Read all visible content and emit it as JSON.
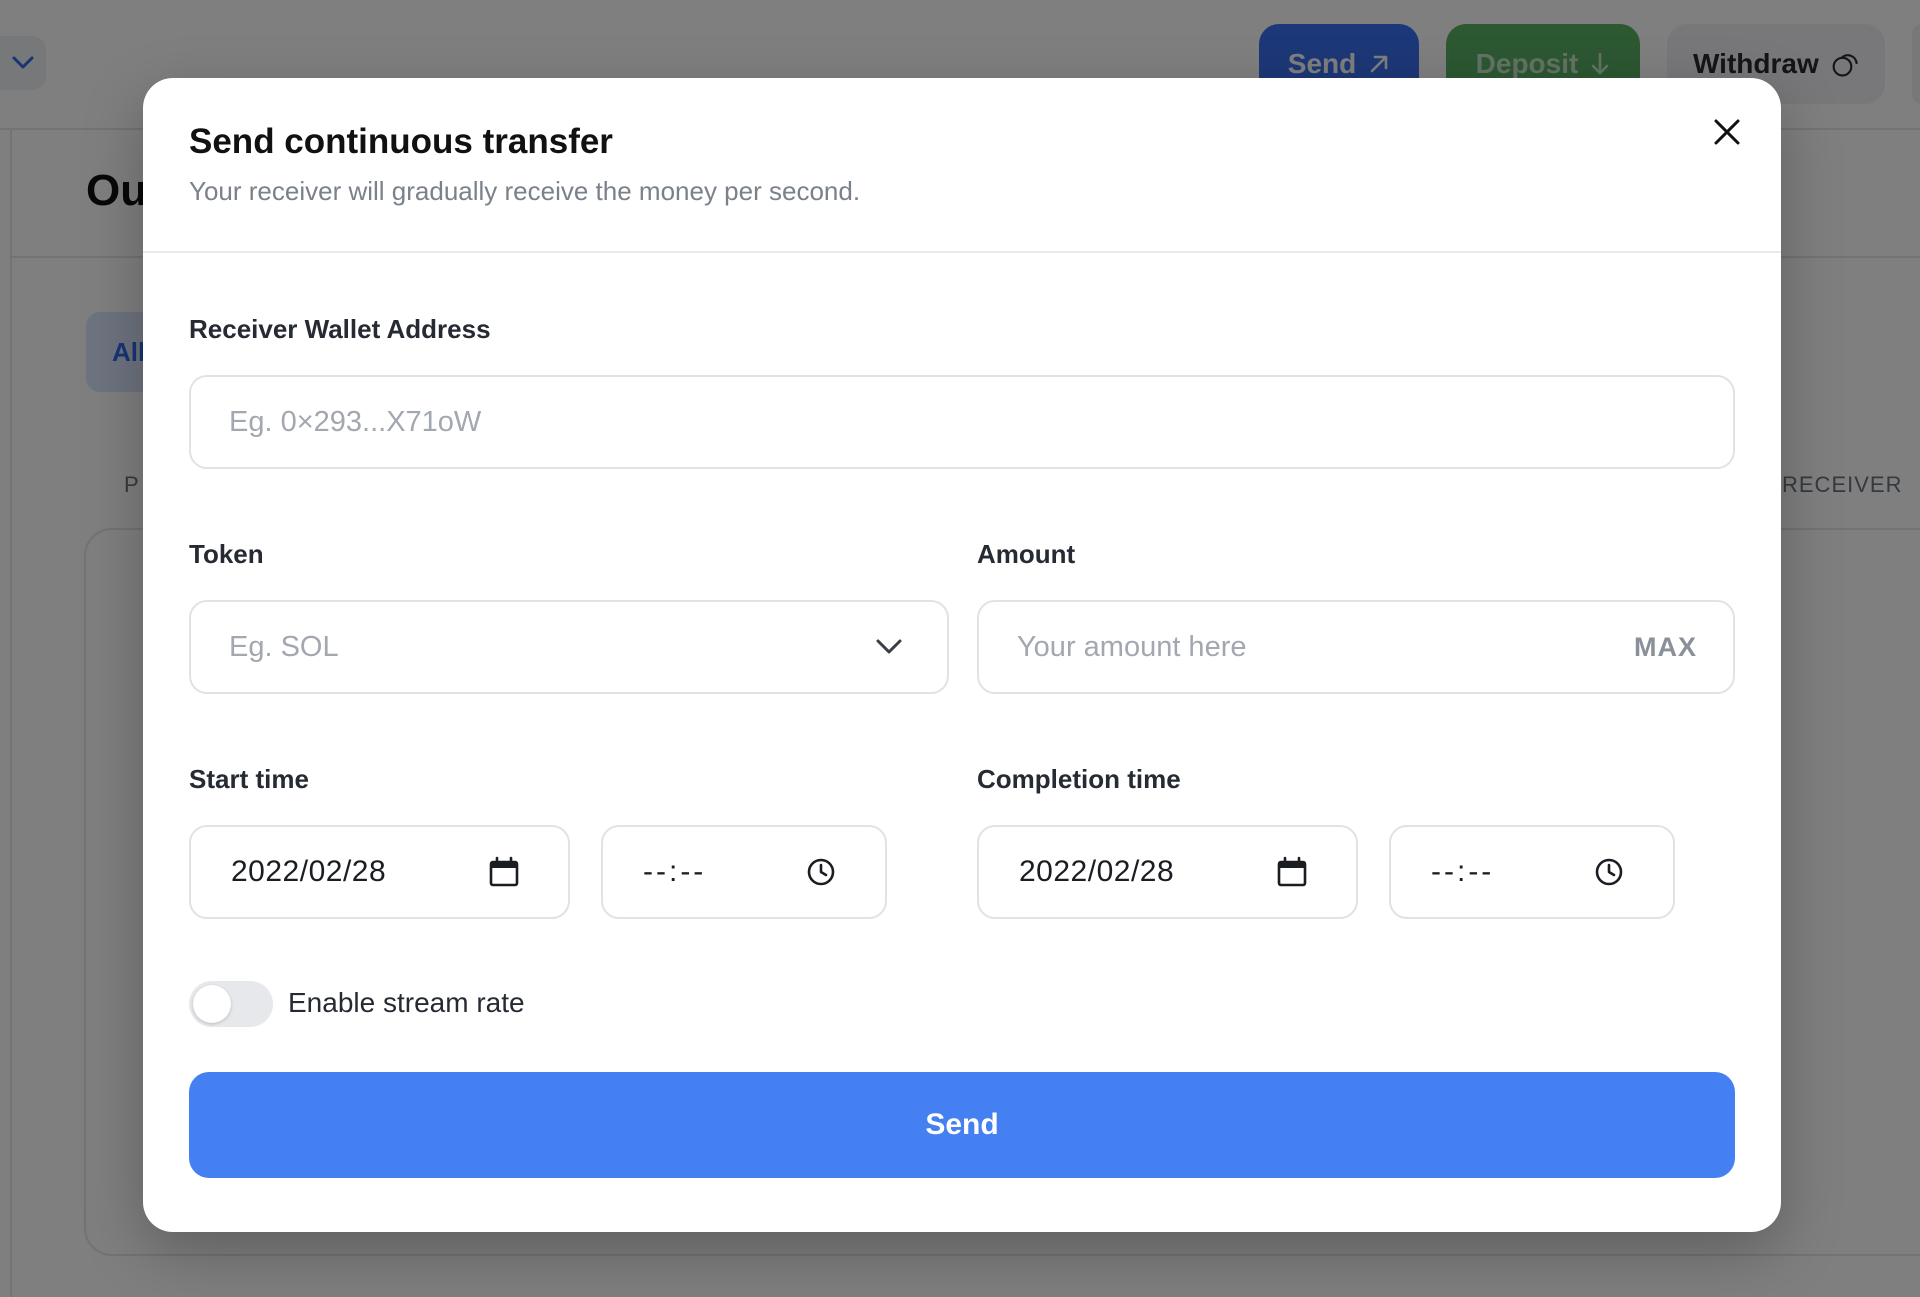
{
  "background": {
    "header": {
      "send_label": "Send",
      "deposit_label": "Deposit",
      "withdraw_label": "Withdraw"
    },
    "heading": "Ou",
    "filter_tab": "All",
    "column_left": "P",
    "column_right": "RECEIVER"
  },
  "modal": {
    "title": "Send continuous transfer",
    "subtitle": "Your receiver will gradually receive the money per second.",
    "receiver": {
      "label": "Receiver Wallet Address",
      "placeholder": "Eg. 0×293...X71oW"
    },
    "token": {
      "label": "Token",
      "placeholder": "Eg. SOL"
    },
    "amount": {
      "label": "Amount",
      "placeholder": "Your amount here",
      "max_label": "MAX"
    },
    "start_time": {
      "label": "Start time",
      "date": "2022/02/28",
      "time": "--:--"
    },
    "completion_time": {
      "label": "Completion time",
      "date": "2022/02/28",
      "time": "--:--"
    },
    "stream_rate": {
      "label": "Enable stream rate",
      "enabled": false
    },
    "send_label": "Send"
  },
  "colors": {
    "primary": "#4580f2",
    "deposit": "#58b065",
    "overlay": "rgba(0,0,0,0.5)"
  }
}
